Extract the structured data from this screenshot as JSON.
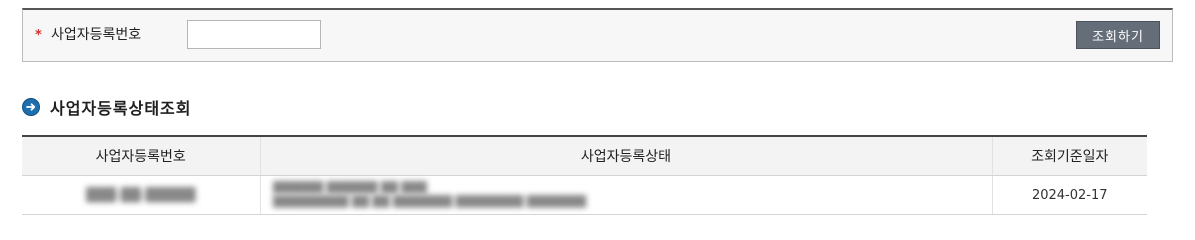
{
  "search": {
    "required_mark": "*",
    "label": "사업자등록번호",
    "input_value": "",
    "button_label": "조회하기"
  },
  "section": {
    "title": "사업자등록상태조회",
    "icon": "arrow-circle-right-icon",
    "icon_color": "#1d6fae"
  },
  "table": {
    "headers": [
      "사업자등록번호",
      "사업자등록상태",
      "조회기준일자"
    ],
    "rows": [
      {
        "business_number": "███-██-█████",
        "status_line1": "██████ ██████ ██ ███",
        "status_line2": "█████████ ██ ██ ███████ ████████ ███████",
        "reference_date": "2024-02-17"
      }
    ]
  },
  "colors": {
    "required": "#d0312d",
    "button_bg": "#646d78",
    "header_bg": "#f3f3f3"
  }
}
